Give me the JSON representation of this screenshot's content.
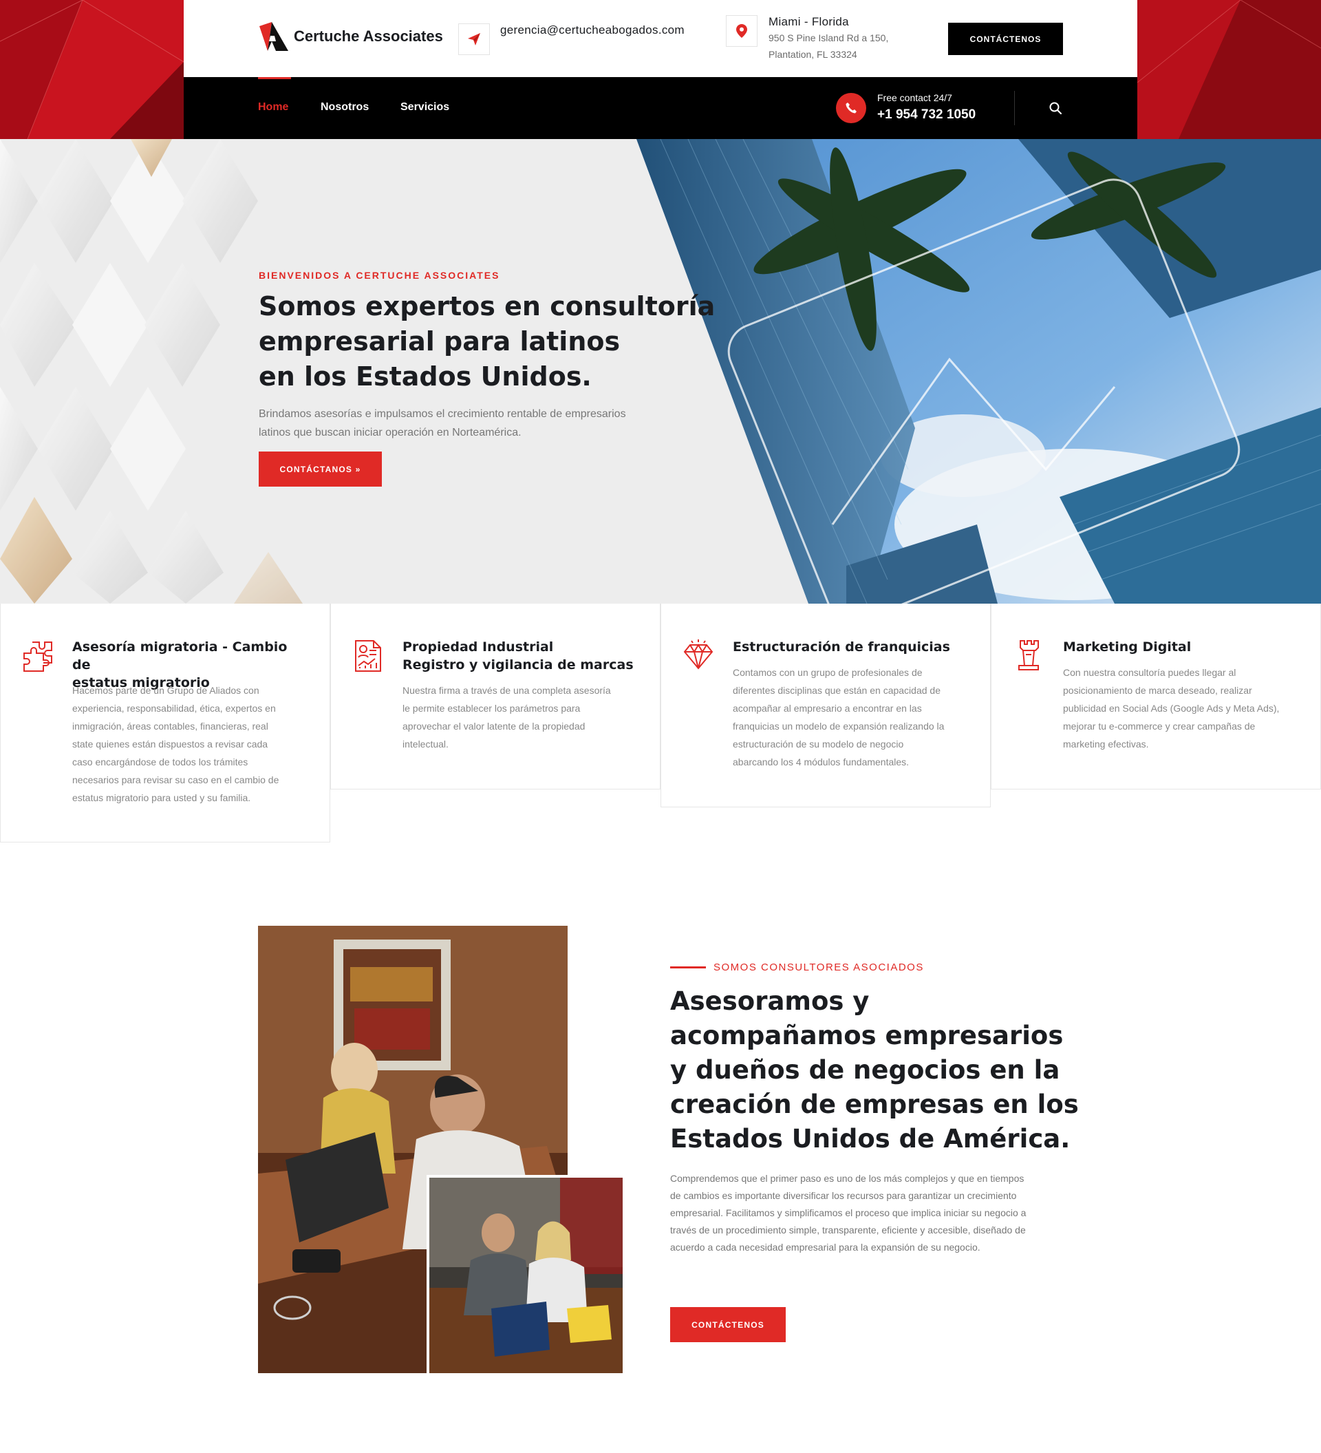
{
  "brand": {
    "name": "Certuche Associates"
  },
  "header": {
    "email": "gerencia@certucheabogados.com",
    "location_title": "Miami - Florida",
    "address_line1": "950 S Pine Island Rd a 150,",
    "address_line2": "Plantation, FL 33324",
    "cta_label": "CONTÁCTENOS"
  },
  "nav": {
    "items": [
      {
        "label": "Home",
        "active": true
      },
      {
        "label": "Nosotros",
        "active": false
      },
      {
        "label": "Servicios",
        "active": false
      }
    ],
    "phone_caption": "Free contact 24/7",
    "phone_number": "+1 954 732 1050"
  },
  "hero": {
    "kicker": "BIENVENIDOS A CERTUCHE ASSOCIATES",
    "title_lines": [
      "Somos expertos en consultoría",
      "empresarial para latinos",
      "en los Estados Unidos."
    ],
    "desc_lines": [
      "Brindamos asesorías e impulsamos el crecimiento rentable de empresarios",
      "latinos que buscan iniciar operación en Norteamérica."
    ],
    "cta_label": "CONTÁCTANOS »"
  },
  "services": [
    {
      "icon": "puzzle-icon",
      "title_lines": [
        "Asesoría migratoria - Cambio de",
        "estatus migratorio"
      ],
      "text_lines": [
        "Hacemos parte de un Grupo de Aliados con",
        "experiencia, responsabilidad, ética, expertos en",
        "inmigración, áreas contables, financieras, real",
        "state quienes están dispuestos a revisar cada",
        "caso encargándose de todos los trámites",
        "necesarios para revisar su caso en el cambio de",
        "estatus migratorio para usted y su familia."
      ]
    },
    {
      "icon": "report-icon",
      "title_lines": [
        "Propiedad Industrial",
        "Registro y vigilancia de marcas"
      ],
      "text_lines": [
        "Nuestra firma a través de una completa asesoría",
        "le permite establecer los parámetros para",
        "aprovechar el valor latente de la propiedad",
        "intelectual."
      ]
    },
    {
      "icon": "diamond-icon",
      "title_lines": [
        "Estructuración de franquicias"
      ],
      "text_lines": [
        "Contamos con un grupo de profesionales de",
        "diferentes disciplinas que están en capacidad de",
        "acompañar al empresario a encontrar en las",
        "franquicias un modelo de expansión realizando la",
        "estructuración de su modelo de negocio",
        "abarcando los 4 módulos fundamentales."
      ]
    },
    {
      "icon": "rook-icon",
      "title_lines": [
        "Marketing Digital"
      ],
      "text_lines": [
        "Con nuestra consultoría puedes llegar al",
        "posicionamiento de marca deseado, realizar",
        "publicidad en Social Ads (Google Ads y Meta Ads),",
        "mejorar tu e-commerce y crear campañas de",
        "marketing efectivas."
      ]
    }
  ],
  "about": {
    "kicker": "SOMOS CONSULTORES ASOCIADOS",
    "title_lines": [
      "Asesoramos y",
      "acompañamos empresarios",
      "y dueños de negocios en la",
      "creación de empresas en los",
      "Estados Unidos de América."
    ],
    "text_lines": [
      "Comprendemos que el primer paso es uno de los más complejos y que en tiempos",
      "de cambios es importante diversificar los recursos para garantizar un crecimiento",
      "empresarial. Facilitamos y simplificamos el proceso que implica iniciar su negocio a",
      "través de un procedimiento simple, transparente, eficiente y accesible, diseñado de",
      "acuerdo a cada necesidad empresarial para la expansión de su negocio."
    ],
    "cta_label": "CONTÁCTENOS"
  },
  "colors": {
    "accent": "#e02a26",
    "dark": "#000000",
    "text": "#1b1d21"
  }
}
